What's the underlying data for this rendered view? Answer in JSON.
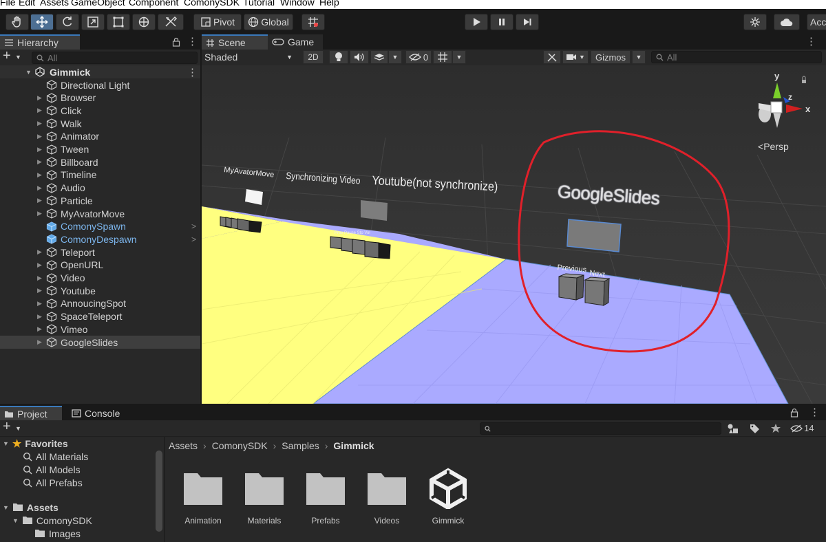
{
  "menu": [
    "File",
    "Edit",
    "Assets",
    "GameObject",
    "Component",
    "ComonySDK",
    "Tutorial",
    "Window",
    "Help"
  ],
  "toolbar": {
    "pivot": "Pivot",
    "global": "Global",
    "account": "Acc"
  },
  "hierarchy": {
    "tab": "Hierarchy",
    "search_placeholder": "All",
    "root": "Gimmick",
    "items": [
      {
        "label": "Directional Light",
        "expandable": false,
        "prefab": false
      },
      {
        "label": "Browser",
        "expandable": true,
        "prefab": false
      },
      {
        "label": "Click",
        "expandable": true,
        "prefab": false
      },
      {
        "label": "Walk",
        "expandable": true,
        "prefab": false
      },
      {
        "label": "Animator",
        "expandable": true,
        "prefab": false
      },
      {
        "label": "Tween",
        "expandable": true,
        "prefab": false
      },
      {
        "label": "Billboard",
        "expandable": true,
        "prefab": false
      },
      {
        "label": "Timeline",
        "expandable": true,
        "prefab": false
      },
      {
        "label": "Audio",
        "expandable": true,
        "prefab": false
      },
      {
        "label": "Particle",
        "expandable": true,
        "prefab": false
      },
      {
        "label": "MyAvatorMove",
        "expandable": true,
        "prefab": false
      },
      {
        "label": "ComonySpawn",
        "expandable": false,
        "prefab": true
      },
      {
        "label": "ComonyDespawn",
        "expandable": false,
        "prefab": true
      },
      {
        "label": "Teleport",
        "expandable": true,
        "prefab": false
      },
      {
        "label": "OpenURL",
        "expandable": true,
        "prefab": false
      },
      {
        "label": "Video",
        "expandable": true,
        "prefab": false
      },
      {
        "label": "Youtube",
        "expandable": true,
        "prefab": false
      },
      {
        "label": "AnnoucingSpot",
        "expandable": true,
        "prefab": false
      },
      {
        "label": "SpaceTeleport",
        "expandable": true,
        "prefab": false
      },
      {
        "label": "Vimeo",
        "expandable": true,
        "prefab": false
      },
      {
        "label": "GoogleSlides",
        "expandable": true,
        "prefab": false
      }
    ]
  },
  "scene": {
    "tabs": [
      "Scene",
      "Game"
    ],
    "shading": "Shaded",
    "mode2d": "2D",
    "hidden_count": "0",
    "gizmos": "Gizmos",
    "search_placeholder": "All",
    "persp": "Persp",
    "axis": {
      "x": "x",
      "y": "y",
      "z": "z"
    },
    "labels": {
      "avatar_move": "MyAvatorMove",
      "sync_video": "Synchronizing Video",
      "youtube": "Youtube(not synchronize)",
      "google_slides": "GoogleSlides",
      "previous": "Previous",
      "next": "Next"
    }
  },
  "project": {
    "tabs": [
      "Project",
      "Console"
    ],
    "hidden_count": "14",
    "breadcrumb": [
      "Assets",
      "ComonySDK",
      "Samples",
      "Gimmick"
    ],
    "favorites": {
      "title": "Favorites",
      "items": [
        "All Materials",
        "All Models",
        "All Prefabs"
      ]
    },
    "tree": {
      "assets": "Assets",
      "comonysdk": "ComonySDK",
      "images": "Images"
    },
    "assets": [
      "Animation",
      "Materials",
      "Prefabs",
      "Videos",
      "Gimmick"
    ]
  },
  "colors": {
    "accent": "#3a79bb",
    "selection": "#4d6f93",
    "prefab_text": "#7cb5ec",
    "floor_yellow": "#ffff80",
    "floor_purple": "#aaaaff",
    "annotation": "#e0202a"
  }
}
